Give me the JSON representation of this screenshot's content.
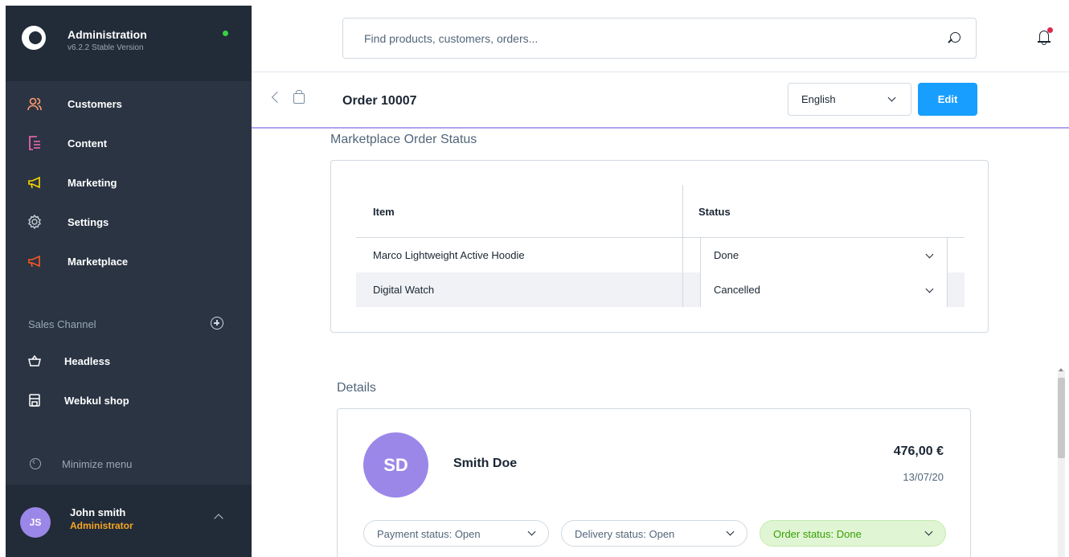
{
  "sidebar": {
    "app_title": "Administration",
    "version": "v6.2.2 Stable Version",
    "nav": [
      {
        "label": "Customers",
        "icon": "customers-icon",
        "color": "#ff9b6b"
      },
      {
        "label": "Content",
        "icon": "content-icon",
        "color": "#ff68b4"
      },
      {
        "label": "Marketing",
        "icon": "marketing-icon",
        "color": "#ffd700"
      },
      {
        "label": "Settings",
        "icon": "settings-icon",
        "color": "#9aa8b5"
      },
      {
        "label": "Marketplace",
        "icon": "marketplace-icon",
        "color": "#ff5722"
      }
    ],
    "sales_channel_title": "Sales Channel",
    "channels": [
      {
        "label": "Headless",
        "icon": "basket-icon"
      },
      {
        "label": "Webkul shop",
        "icon": "shop-icon"
      }
    ],
    "minimize_label": "Minimize menu",
    "user": {
      "initials": "JS",
      "name": "John smith",
      "role": "Administrator"
    }
  },
  "topbar": {
    "search_placeholder": "Find products, customers, orders..."
  },
  "page": {
    "title": "Order 10007",
    "language": "English",
    "edit_label": "Edit"
  },
  "marketplace": {
    "title": "Marketplace Order Status",
    "columns": [
      "Item",
      "Status"
    ],
    "rows": [
      {
        "item": "Marco Lightweight Active Hoodie",
        "status": "Done"
      },
      {
        "item": "Digital Watch",
        "status": "Cancelled"
      }
    ]
  },
  "details": {
    "title": "Details",
    "customer_initials": "SD",
    "customer_name": "Smith Doe",
    "amount": "476,00 €",
    "date": "13/07/20",
    "payment_status": "Payment status: Open",
    "delivery_status": "Delivery status: Open",
    "order_status": "Order status: Done"
  },
  "colors": {
    "sidebar_bg": "#2a3443",
    "accent": "#189eff",
    "avatar": "#9b87e8",
    "done_green": "#37a000"
  }
}
